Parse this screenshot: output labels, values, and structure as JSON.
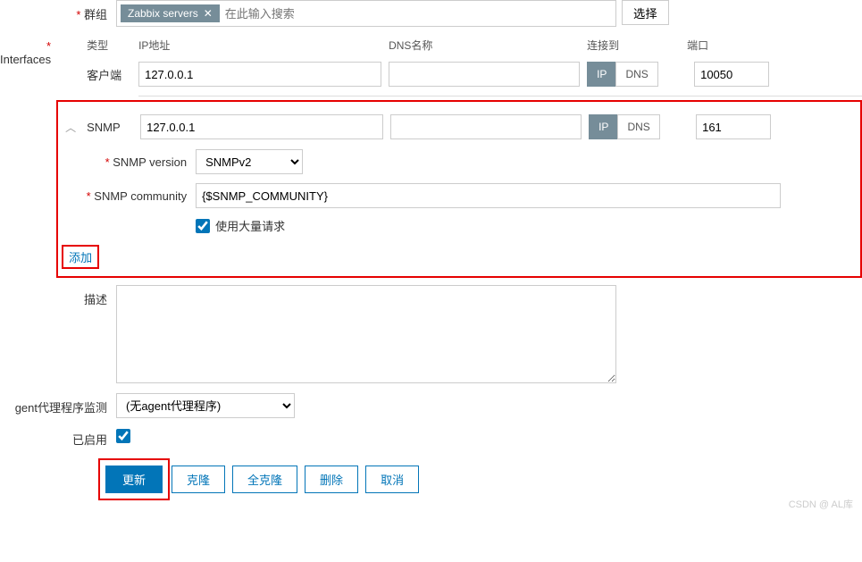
{
  "labels": {
    "groups": "群组",
    "interfaces": "Interfaces",
    "description": "描述",
    "proxy": "gent代理程序监测",
    "enabled": "已启用",
    "snmp_version": "SNMP version",
    "snmp_community": "SNMP community",
    "bulk": "使用大量请求"
  },
  "groups": {
    "tag": "Zabbix servers",
    "placeholder": "在此输入搜索",
    "select_btn": "选择"
  },
  "iface_headers": {
    "type": "类型",
    "ip": "IP地址",
    "dns": "DNS名称",
    "connect": "连接到",
    "port": "端口"
  },
  "interfaces": {
    "agent": {
      "type": "客户端",
      "ip": "127.0.0.1",
      "dns": "",
      "conn_ip": "IP",
      "conn_dns": "DNS",
      "port": "10050"
    },
    "snmp": {
      "type": "SNMP",
      "ip": "127.0.0.1",
      "dns": "",
      "conn_ip": "IP",
      "conn_dns": "DNS",
      "port": "161",
      "version": "SNMPv2",
      "community": "{$SNMP_COMMUNITY}"
    },
    "add": "添加"
  },
  "proxy_select": "(无agent代理程序)",
  "buttons": {
    "update": "更新",
    "clone": "克隆",
    "full_clone": "全克隆",
    "delete": "删除",
    "cancel": "取消"
  },
  "watermark": "CSDN @ AL库"
}
